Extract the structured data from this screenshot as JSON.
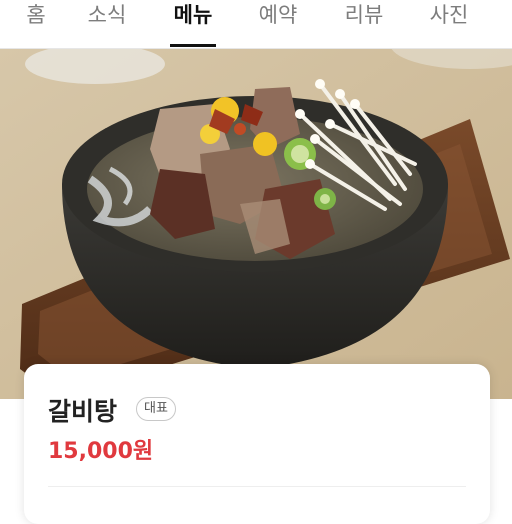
{
  "tabs": [
    {
      "label": "홈",
      "active": false
    },
    {
      "label": "소식",
      "active": false
    },
    {
      "label": "메뉴",
      "active": true
    },
    {
      "label": "예약",
      "active": false
    },
    {
      "label": "리뷰",
      "active": false
    },
    {
      "label": "사진",
      "active": false
    }
  ],
  "menu_item": {
    "name": "갈비탕",
    "badge": "대표",
    "price": "15,000원",
    "price_color": "#e0393e"
  }
}
